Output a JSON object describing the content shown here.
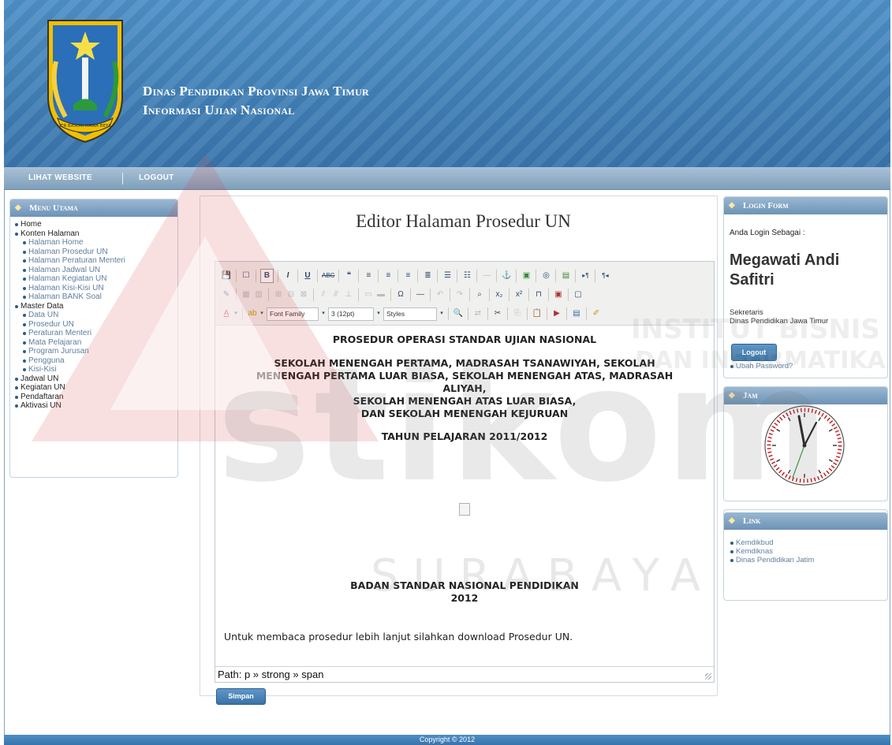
{
  "header": {
    "title_line1": "Dinas Pendidikan Provinsi Jawa Timur",
    "title_line2": "Informasi Ujian Nasional",
    "logo_caption": "JER BASUKI MAWA BEYA"
  },
  "nav": {
    "items": [
      "LIHAT WEBSITE",
      "LOGOUT"
    ]
  },
  "menu": {
    "title": "Menu Utama",
    "items": [
      {
        "label": "Home",
        "level": 1
      },
      {
        "label": "Konten Halaman",
        "level": 1
      },
      {
        "label": "Halaman Home",
        "level": 2
      },
      {
        "label": "Halaman Prosedur UN",
        "level": 2
      },
      {
        "label": "Halaman Peraturan Menteri",
        "level": 2
      },
      {
        "label": "Halaman Jadwal UN",
        "level": 2
      },
      {
        "label": "Halaman Kegiatan UN",
        "level": 2
      },
      {
        "label": "Halaman Kisi-Kisi UN",
        "level": 2
      },
      {
        "label": "Halaman BANK Soal",
        "level": 2
      },
      {
        "label": "Master Data",
        "level": 1
      },
      {
        "label": "Data UN",
        "level": 2
      },
      {
        "label": "Prosedur UN",
        "level": 2
      },
      {
        "label": "Peraturan Menteri",
        "level": 2
      },
      {
        "label": "Mata Pelajaran",
        "level": 2
      },
      {
        "label": "Program Jurusan",
        "level": 2
      },
      {
        "label": "Pengguna",
        "level": 2
      },
      {
        "label": "Kisi-Kisi",
        "level": 2
      },
      {
        "label": "Jadwal UN",
        "level": 1
      },
      {
        "label": "Kegiatan UN",
        "level": 1
      },
      {
        "label": "Pendaftaran",
        "level": 1
      },
      {
        "label": "Aktivasi UN",
        "level": 1
      }
    ]
  },
  "main": {
    "page_title": "Editor Halaman Prosedur UN",
    "toolbar": {
      "font_family": "Font Family",
      "font_size": "3 (12pt)",
      "styles": "Styles"
    },
    "doc": {
      "heading": "PROSEDUR OPERASI STANDAR UJIAN NASIONAL",
      "school_lines": [
        "SEKOLAH MENENGAH PERTAMA, MADRASAH TSANAWIYAH, SEKOLAH",
        "MENENGAH PERTAMA LUAR BIASA, SEKOLAH MENENGAH ATAS, MADRASAH",
        "ALIYAH,",
        "SEKOLAH MENENGAH ATAS LUAR BIASA,",
        "DAN SEKOLAH MENENGAH KEJURUAN"
      ],
      "year": "TAHUN PELAJARAN 2011/2012",
      "agency": "BADAN STANDAR NASIONAL PENDIDIKAN",
      "agency_year": "2012",
      "paragraph": "Untuk membaca prosedur lebih lanjut silahkan download Prosedur UN."
    },
    "path": "Path: p » strong » span",
    "save_label": "Simpan"
  },
  "login": {
    "title": "Login Form",
    "label": "Anda Login Sebagai :",
    "name": "Megawati Andi Safitri",
    "role_line1": "Sekretaris",
    "role_line2": "Dinas Pendidikan Jawa Timur",
    "logout_label": "Logout",
    "change_password": "Ubah Password?"
  },
  "clock": {
    "title": "Jam"
  },
  "links": {
    "title": "Link",
    "items": [
      "Kemdikbud",
      "Kemdiknas",
      "Dinas Pendidikan Jatim"
    ]
  },
  "watermark": {
    "main": "stikom",
    "sub": "SURABAYA",
    "top": "INSTITUT BISNIS",
    "top2": "DAN INFORMATIKA"
  },
  "footer": {
    "text": "Copyright © 2012"
  }
}
